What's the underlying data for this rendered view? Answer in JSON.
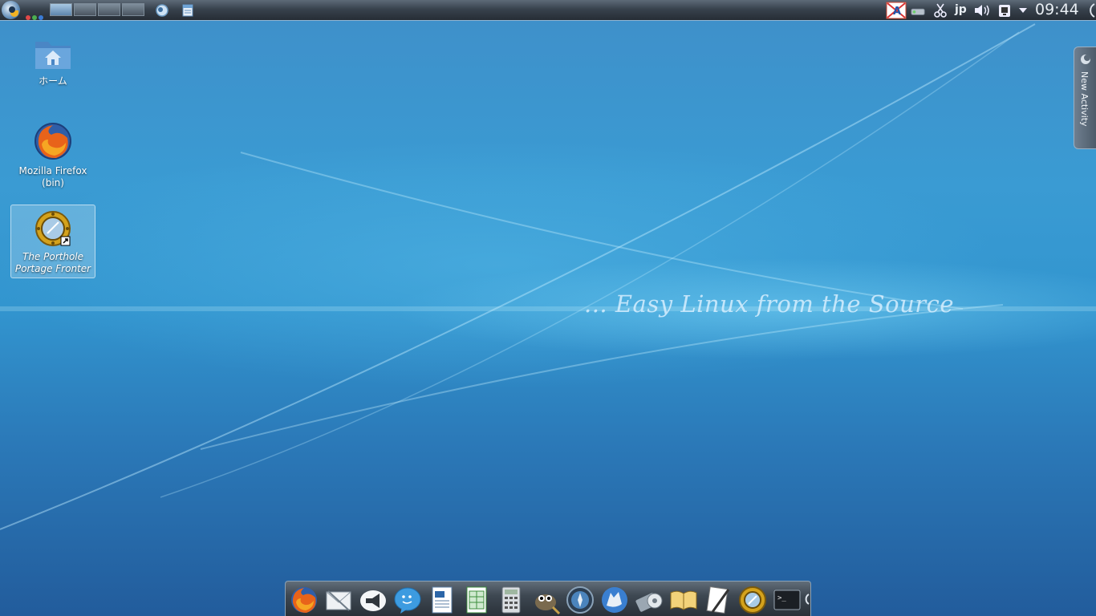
{
  "wallpaper": {
    "tagline": "... Easy Linux from the Source"
  },
  "top_panel": {
    "kmenu_icon": "sabayon-kmenu-icon",
    "window_dots": [
      "#e04848",
      "#4caf50",
      "#3a7bd5"
    ],
    "virtual_desktops": [
      1,
      2,
      3,
      4
    ],
    "active_desktop": 1,
    "launchers": [
      "sabayon-icon",
      "notes-icon"
    ],
    "tray": {
      "icons": [
        "language-indicator-icon",
        "network-icon",
        "klipper-scissors-icon",
        "volume-icon",
        "device-notifier-icon",
        "expand-tray-icon"
      ],
      "input_method": "jp",
      "clock": "09:44"
    }
  },
  "desktop_icons": [
    {
      "label": "ホーム",
      "icon": "home-folder-icon"
    },
    {
      "label": "Mozilla Firefox (bin)",
      "line1": "Mozilla Firefox",
      "line2": "(bin)",
      "icon": "firefox-icon"
    },
    {
      "label": "The Porthole Portage Frontend",
      "line1": "The Porthole",
      "line2": "Portage Fronter",
      "icon": "porthole-icon"
    }
  ],
  "activity_tab": {
    "label": "New Activity"
  },
  "dock": {
    "items": [
      "firefox-icon",
      "mail-icon",
      "announce-megaphone-icon",
      "chat-icon",
      "writer-document-icon",
      "calc-spreadsheet-icon",
      "calculator-icon",
      "gimp-icon",
      "compass-icon",
      "kopete-wolf-icon",
      "media-player-icon",
      "dictionary-book-icon",
      "text-editor-icon",
      "porthole-icon",
      "terminal-icon"
    ]
  }
}
